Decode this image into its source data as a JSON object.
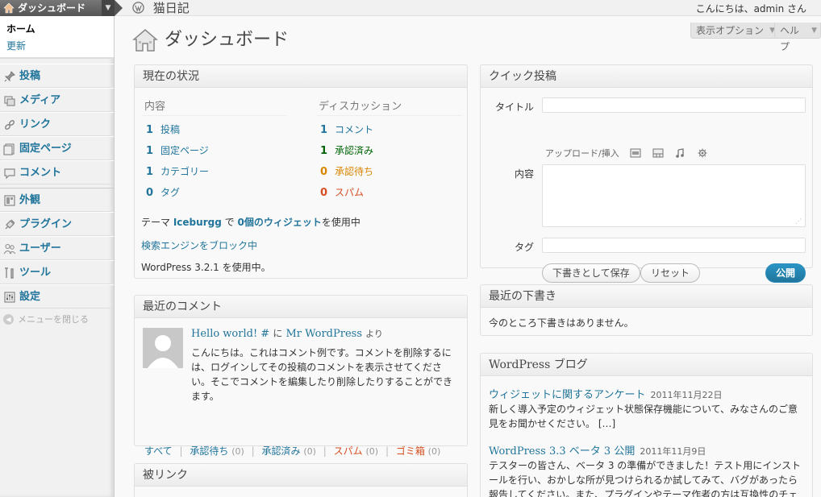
{
  "header": {
    "dashboard_tab": "ダッシュボード",
    "site_title": "猫日記",
    "greeting": "こんにちは、admin さん"
  },
  "menu": {
    "submenu": {
      "home": "ホーム",
      "update": "更新"
    },
    "items": [
      {
        "label": "投稿",
        "icon": "pin-icon"
      },
      {
        "label": "メディア",
        "icon": "media-icon"
      },
      {
        "label": "リンク",
        "icon": "link-icon"
      },
      {
        "label": "固定ページ",
        "icon": "pages-icon"
      },
      {
        "label": "コメント",
        "icon": "comment-icon"
      },
      {
        "label": "外観",
        "icon": "appearance-icon"
      },
      {
        "label": "プラグイン",
        "icon": "plugin-icon"
      },
      {
        "label": "ユーザー",
        "icon": "users-icon"
      },
      {
        "label": "ツール",
        "icon": "tools-icon"
      },
      {
        "label": "設定",
        "icon": "settings-icon"
      }
    ],
    "collapse": "メニューを閉じる"
  },
  "page": {
    "title": "ダッシュボード",
    "screen_options": "表示オプション",
    "help": "ヘルプ"
  },
  "right_now": {
    "title": "現在の状況",
    "content_head": "内容",
    "discussion_head": "ディスカッション",
    "content": [
      {
        "num": "1",
        "label": "投稿"
      },
      {
        "num": "1",
        "label": "固定ページ"
      },
      {
        "num": "1",
        "label": "カテゴリー"
      },
      {
        "num": "0",
        "label": "タグ"
      }
    ],
    "discussion": [
      {
        "num": "1",
        "label": "コメント"
      },
      {
        "num": "1",
        "label": "承認済み"
      },
      {
        "num": "0",
        "label": "承認待ち"
      },
      {
        "num": "0",
        "label": "スパム"
      }
    ],
    "theme_prefix": "テーマ",
    "theme_name": "Iceburgg",
    "theme_mid": "で",
    "widgets_link": "0個のウィジェット",
    "theme_suffix": "を使用中",
    "search_engine_link": "検索エンジンをブロック中",
    "version_text": "WordPress 3.2.1 を使用中。"
  },
  "quick_press": {
    "title": "クイック投稿",
    "title_label": "タイトル",
    "upload_label": "アップロード/挿入",
    "content_label": "内容",
    "tags_label": "タグ",
    "save_draft": "下書きとして保存",
    "reset": "リセット",
    "publish": "公開"
  },
  "recent_comments": {
    "title": "最近のコメント",
    "post_link": "Hello world! #",
    "on_text": "に",
    "author_link": "Mr WordPress",
    "from_text": "より",
    "body": "こんにちは。これはコメント例です。コメントを削除するには、ログインしてその投稿のコメントを表示させてください。そこでコメントを編集したり削除したりすることができます。",
    "links": [
      {
        "label": "すべて",
        "count": ""
      },
      {
        "label": "承認待ち",
        "count": "(0)"
      },
      {
        "label": "承認済み",
        "count": "(0)"
      },
      {
        "label": "スパム",
        "count": "(0)"
      },
      {
        "label": "ゴミ箱",
        "count": "(0)"
      }
    ]
  },
  "recent_drafts": {
    "title": "最近の下書き",
    "empty": "今のところ下書きはありません。"
  },
  "incoming_links": {
    "title": "被リンク"
  },
  "blog": {
    "title": "WordPress ブログ",
    "posts": [
      {
        "title": "ウィジェットに関するアンケート",
        "date": "2011年11月22日",
        "text": "新しく導入予定のウィジェット状態保存機能について、みなさんのご意見をお聞かせください。 […]"
      },
      {
        "title": "WordPress 3.3 ベータ 3 公開",
        "date": "2011年11月9日",
        "text": "テスターの皆さん、ベータ 3 の準備ができました！テスト用にインストールを行い、おかしな所が見つけられるか試してみて、バグがあったら報告してください。また、プラグインやテーマ作者の方は互換性のチェックをお願いします。"
      }
    ]
  },
  "colors": {
    "link": "#21759b",
    "approved": "#006505",
    "pending": "#d98500",
    "spam": "#d54e21",
    "primary_button": "#21759b"
  }
}
